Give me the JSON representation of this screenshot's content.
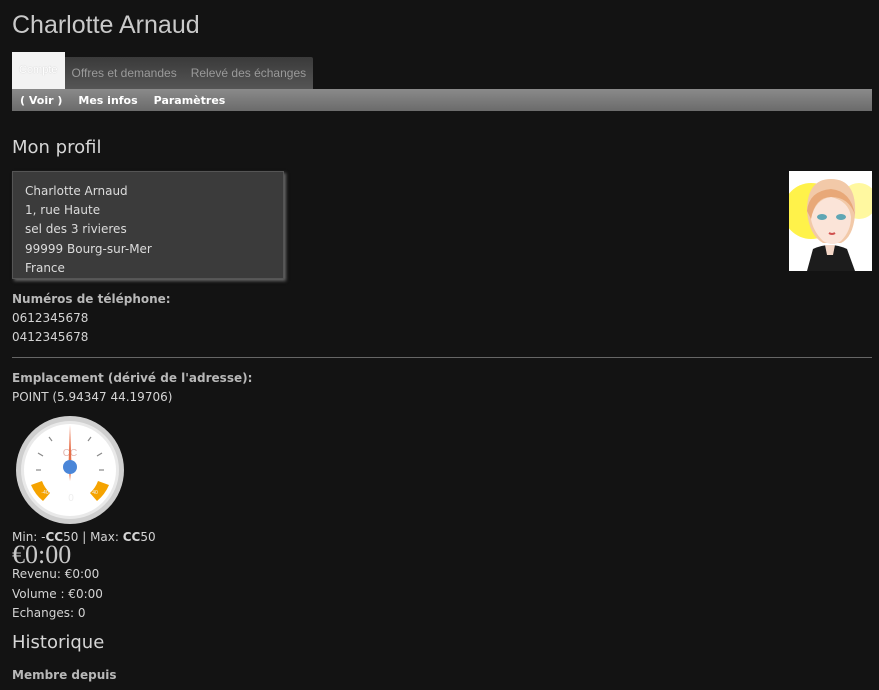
{
  "header": {
    "title": "Charlotte Arnaud"
  },
  "tabs": [
    {
      "label": "Compte",
      "active": true
    },
    {
      "label": "Offres et demandes",
      "active": false
    },
    {
      "label": "Relevé des échanges",
      "active": false
    }
  ],
  "subtabs": [
    {
      "label": "( Voir )"
    },
    {
      "label": "Mes infos"
    },
    {
      "label": "Paramètres"
    }
  ],
  "profile": {
    "heading": "Mon profil",
    "address": [
      "Charlotte Arnaud",
      "1, rue Haute",
      "sel des 3 rivieres",
      "99999 Bourg-sur-Mer",
      "France"
    ],
    "phones_label": "Numéros de téléphone:",
    "phones": [
      "0612345678",
      "0412345678"
    ],
    "location_label": "Emplacement (dérivé de l'adresse):",
    "location_value": "POINT (5.94347 44.19706)"
  },
  "gauge": {
    "unit": "CC",
    "value": "0",
    "tick_left": "-40",
    "tick_right": "40",
    "current": 0,
    "min": -50,
    "max": 50,
    "colors": {
      "needle": "#e8704a",
      "hub": "#4a86d8",
      "zone": "#f5a300"
    }
  },
  "balance": {
    "minmax_prefix": "Min: -",
    "min_unit": "CC",
    "min_value": "50",
    "sep": " | Max: ",
    "max_unit": "CC",
    "max_value": "50",
    "amount": "€0:00",
    "revenue": "Revenu: €0:00",
    "volume": "Volume : €0:00",
    "exchanges": "Echanges: 0"
  },
  "history": {
    "heading": "Historique",
    "member_since_label": "Membre depuis"
  },
  "icons": {
    "avatar": "avatar-portrait"
  }
}
